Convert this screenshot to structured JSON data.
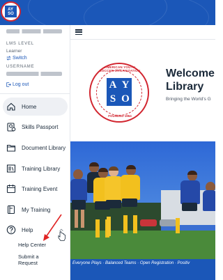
{
  "sidebar": {
    "lms_level_label": "LMS LEVEL",
    "lms_level_value": "Learner",
    "switch_label": "Switch",
    "username_label": "USERNAME",
    "logout_label": "Log out",
    "nav": [
      {
        "label": "Home",
        "icon": "home-icon",
        "active": true
      },
      {
        "label": "Skills Passport",
        "icon": "passport-icon"
      },
      {
        "label": "Document Library",
        "icon": "folder-icon"
      },
      {
        "label": "Training Library",
        "icon": "library-icon"
      },
      {
        "label": "Training Event",
        "icon": "calendar-icon"
      },
      {
        "label": "My Training",
        "icon": "book-icon"
      },
      {
        "label": "Help",
        "icon": "question-icon"
      }
    ],
    "help_sub": [
      {
        "label": "Help Center"
      },
      {
        "label": "Submit a Request"
      }
    ]
  },
  "main": {
    "logo_top_text": "AMERICAN YOUTH SOCCER ORGANIZATION",
    "logo_letters": [
      "A",
      "Y",
      "S",
      "O"
    ],
    "logo_bottom_text": "FOUNDED 1964",
    "welcome_title": "Welcome",
    "welcome_title_2": "Library",
    "tagline": "Bringing the World's G",
    "footer_text": "Everyone Plays · Balanced Teams · Open Registration · Positiv"
  },
  "colors": {
    "brand_blue": "#1b57b8",
    "brand_red": "#d22630",
    "annotation_red": "#e02424"
  }
}
